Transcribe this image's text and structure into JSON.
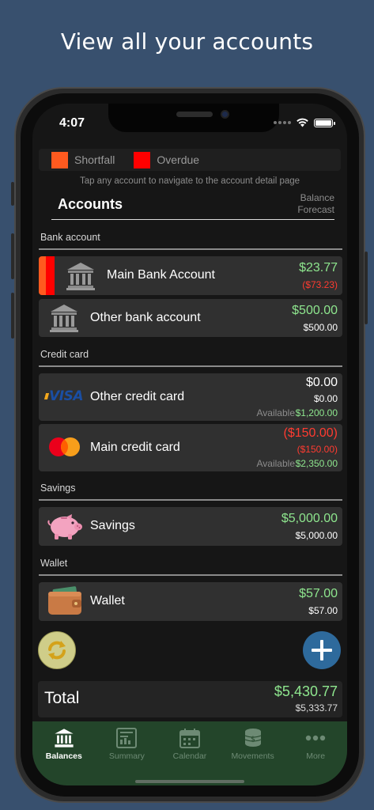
{
  "headline": "View all your accounts",
  "status": {
    "time": "4:07"
  },
  "legend": {
    "shortfall_label": "Shortfall",
    "overdue_label": "Overdue",
    "shortfall_color": "#ff5a1f",
    "overdue_color": "#ff0000"
  },
  "hint": "Tap any account to navigate to the account detail page",
  "header": {
    "title": "Accounts",
    "balance_label": "Balance",
    "forecast_label": "Forecast"
  },
  "sections": {
    "bank": {
      "label": "Bank account",
      "accounts": [
        {
          "name": "Main Bank Account",
          "balance": "$23.77",
          "forecast": "($73.23)",
          "icon": "bank-icon"
        },
        {
          "name": "Other bank account",
          "balance": "$500.00",
          "forecast": "$500.00",
          "icon": "bank-icon"
        }
      ]
    },
    "credit": {
      "label": "Credit card",
      "accounts": [
        {
          "name": "Other credit card",
          "balance": "$0.00",
          "forecast": "$0.00",
          "available_label": "Available",
          "available": "$1,200.00",
          "icon": "visa-icon",
          "logo_text": "VISA"
        },
        {
          "name": "Main credit card",
          "balance": "($150.00)",
          "forecast": "($150.00)",
          "available_label": "Available",
          "available": "$2,350.00",
          "icon": "mastercard-icon"
        }
      ]
    },
    "savings": {
      "label": "Savings",
      "accounts": [
        {
          "name": "Savings",
          "balance": "$5,000.00",
          "forecast": "$5,000.00",
          "icon": "piggy-bank-icon"
        }
      ]
    },
    "wallet": {
      "label": "Wallet",
      "accounts": [
        {
          "name": "Wallet",
          "balance": "$57.00",
          "forecast": "$57.00",
          "icon": "wallet-icon"
        }
      ]
    }
  },
  "total": {
    "label": "Total",
    "balance": "$5,430.77",
    "forecast": "$5,333.77"
  },
  "tabs": [
    {
      "label": "Balances",
      "icon": "bank-icon",
      "active": true
    },
    {
      "label": "Summary",
      "icon": "summary-icon",
      "active": false
    },
    {
      "label": "Calendar",
      "icon": "calendar-icon",
      "active": false
    },
    {
      "label": "Movements",
      "icon": "coins-icon",
      "active": false
    },
    {
      "label": "More",
      "icon": "more-icon",
      "active": false
    }
  ],
  "colors": {
    "background": "#38506e",
    "positive": "#8ee68e",
    "negative": "#ff3b30",
    "tabbar": "#23452a",
    "refresh": "#cfcd89",
    "add": "#2e6a9c"
  }
}
